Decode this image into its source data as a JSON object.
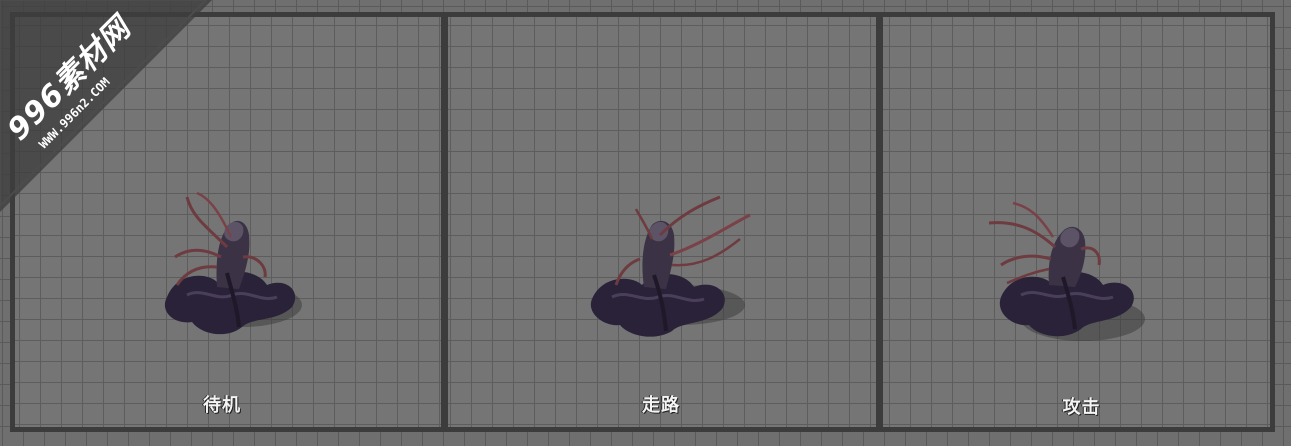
{
  "watermark": {
    "brand": "996素材网",
    "url": "WWW.996n2.COM"
  },
  "panels": [
    {
      "label": "待机",
      "state": "idle"
    },
    {
      "label": "走路",
      "state": "walk"
    },
    {
      "label": "攻击",
      "state": "attack"
    }
  ],
  "colors": {
    "grid_bg": "#757575",
    "grid_line": "#5d5d5d",
    "panel_border": "#3c3c3c",
    "creature_body": "#2a2238",
    "creature_tentacle": "#6e3b40",
    "caption_text": "#f4f4f4"
  }
}
